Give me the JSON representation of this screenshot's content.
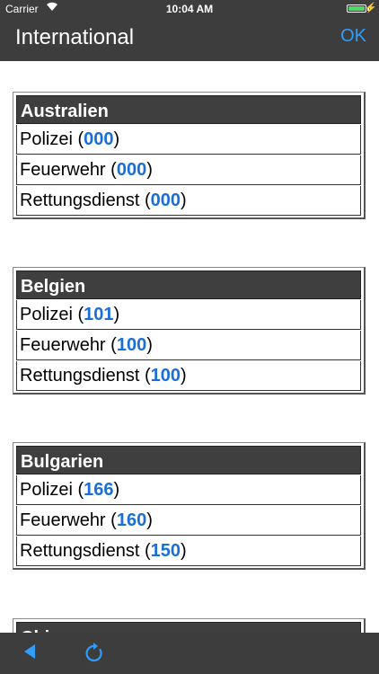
{
  "status": {
    "carrier": "Carrier",
    "time": "10:04 AM",
    "battery_level": 1.0
  },
  "nav": {
    "title": "International",
    "ok_label": "OK"
  },
  "countries": [
    {
      "name": "Australien",
      "services": [
        {
          "label": "Polizei",
          "number": "000"
        },
        {
          "label": "Feuerwehr",
          "number": "000"
        },
        {
          "label": "Rettungsdienst",
          "number": "000"
        }
      ]
    },
    {
      "name": "Belgien",
      "services": [
        {
          "label": "Polizei",
          "number": "101"
        },
        {
          "label": "Feuerwehr",
          "number": "100"
        },
        {
          "label": "Rettungsdienst",
          "number": "100"
        }
      ]
    },
    {
      "name": "Bulgarien",
      "services": [
        {
          "label": "Polizei",
          "number": "166"
        },
        {
          "label": "Feuerwehr",
          "number": "160"
        },
        {
          "label": "Rettungsdienst",
          "number": "150"
        }
      ]
    },
    {
      "name": "China",
      "services": []
    }
  ],
  "toolbar": {
    "back_icon": "back-triangle-icon",
    "reload_icon": "reload-icon"
  },
  "colors": {
    "bar": "#3d3d3d",
    "accent": "#2f9dfb",
    "number": "#1a6fd6"
  }
}
